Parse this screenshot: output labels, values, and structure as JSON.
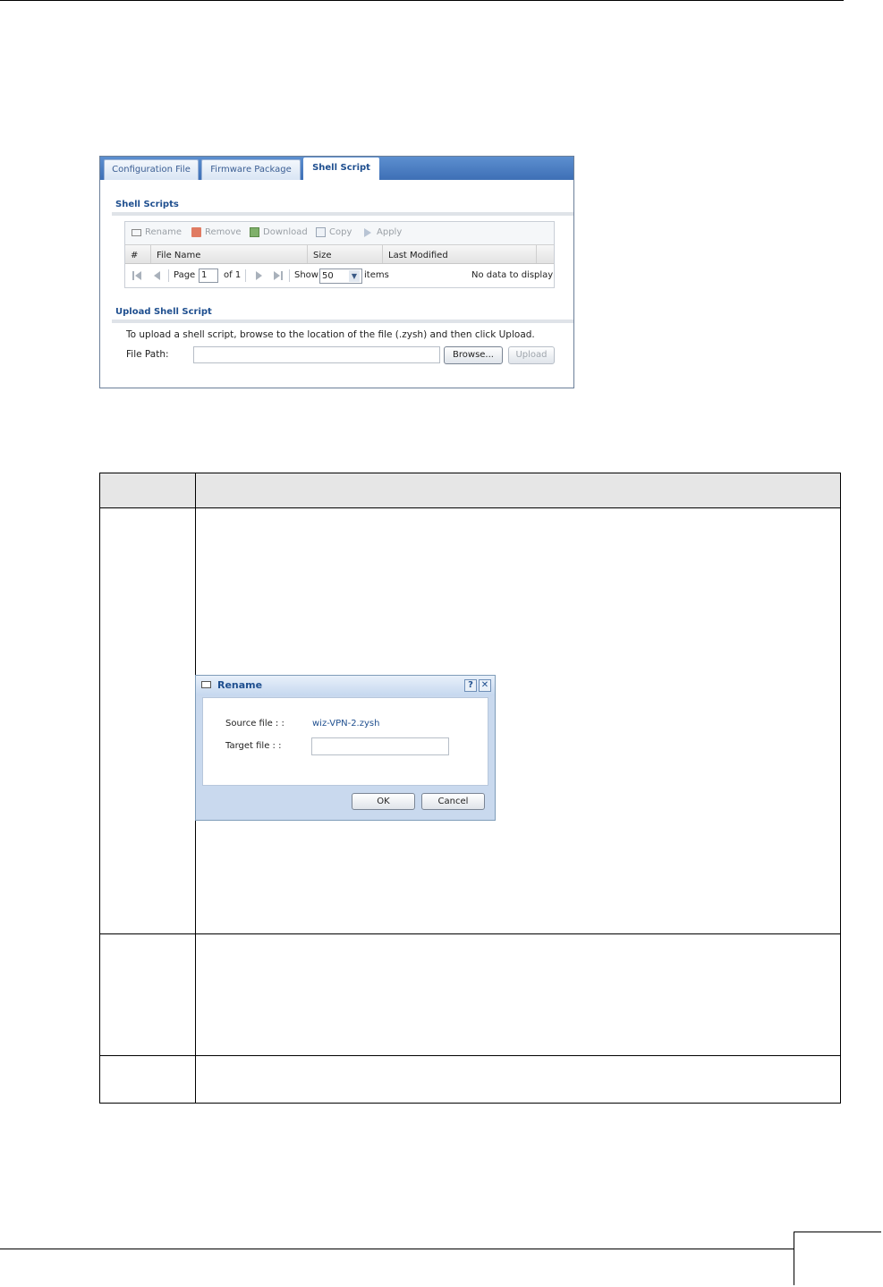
{
  "panel": {
    "tabs": [
      "Configuration File",
      "Firmware Package",
      "Shell Script"
    ],
    "active_tab": "Shell Script",
    "shell_scripts_title": "Shell Scripts",
    "toolbar": {
      "rename": "Rename",
      "remove": "Remove",
      "download": "Download",
      "copy": "Copy",
      "apply": "Apply"
    },
    "columns": [
      "#",
      "File Name",
      "Size",
      "Last Modified"
    ],
    "pager": {
      "page_label": "Page",
      "page_value": "1",
      "of_label": "of 1",
      "show_label": "Show",
      "show_value": "50",
      "items_label": "items",
      "empty_text": "No data to display"
    },
    "upload_title": "Upload Shell Script",
    "upload_instructions": "To upload a shell script, browse to the location of the file (.zysh) and then click Upload.",
    "file_path_label": "File Path:",
    "file_path_value": "",
    "browse_label": "Browse...",
    "upload_label": "Upload"
  },
  "rename_dialog": {
    "title": "Rename",
    "help": "?",
    "close": "✕",
    "source_label": "Source file : :",
    "source_value": "wiz-VPN-2.zysh",
    "target_label": "Target file : :",
    "target_value": "",
    "ok_label": "OK",
    "cancel_label": "Cancel"
  },
  "colors": {
    "tab_bar": "#3e6fb6",
    "section_title": "#1f4f8f",
    "link_value": "#1f4f8f"
  }
}
